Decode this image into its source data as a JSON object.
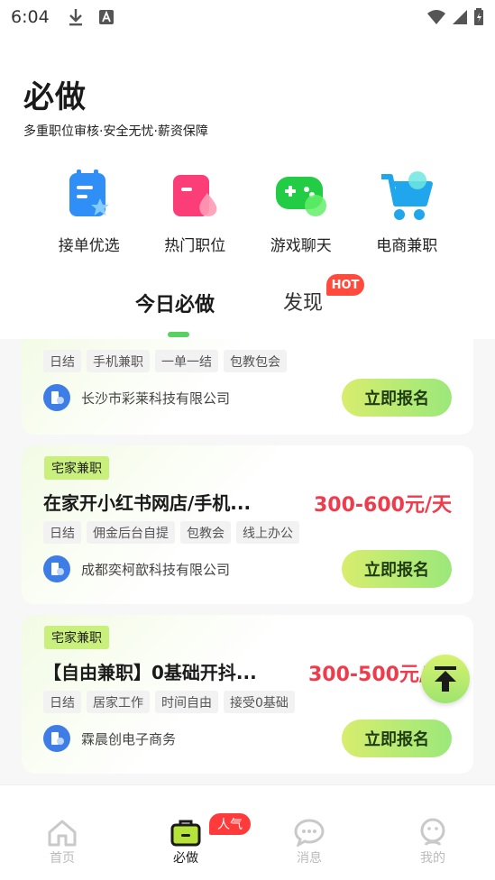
{
  "status_bar": {
    "time": "6:04"
  },
  "header": {
    "title": "必做",
    "subtitle": "多重职位审核·安全无忧·薪资保障"
  },
  "categories": [
    {
      "label": "接单优选",
      "icon": "clipboard-star-icon"
    },
    {
      "label": "热门职位",
      "icon": "hot-folder-icon"
    },
    {
      "label": "游戏聊天",
      "icon": "gamepad-icon"
    },
    {
      "label": "电商兼职",
      "icon": "shopping-cart-icon"
    }
  ],
  "tabs": [
    {
      "label": "今日必做",
      "active": true
    },
    {
      "label": "发现",
      "badge": "HOT"
    }
  ],
  "jobs": [
    {
      "tags": [
        "日结",
        "手机兼职",
        "一单一结",
        "包教包会"
      ],
      "company": "长沙市彩莱科技有限公司",
      "apply_label": "立即报名"
    },
    {
      "category": "宅家兼职",
      "title": "在家开小红书网店/手机...",
      "salary": "300-600元/天",
      "tags": [
        "日结",
        "佣金后台自提",
        "包教会",
        "线上办公"
      ],
      "company": "成都奕柯歆科技有限公司",
      "apply_label": "立即报名"
    },
    {
      "category": "宅家兼职",
      "title": "【自由兼职】0基础开抖...",
      "salary": "300-500元/",
      "tags": [
        "日结",
        "居家工作",
        "时间自由",
        "接受0基础"
      ],
      "company": "霖晨创电子商务",
      "apply_label": "立即报名"
    }
  ],
  "bottom_nav": [
    {
      "label": "首页",
      "icon": "home-icon",
      "active": false
    },
    {
      "label": "必做",
      "icon": "briefcase-icon",
      "active": true,
      "badge": "人气"
    },
    {
      "label": "消息",
      "icon": "chat-bubble-icon",
      "active": false
    },
    {
      "label": "我的",
      "icon": "profile-icon",
      "active": false
    }
  ],
  "colors": {
    "accent_green": "#c9ef7c",
    "salary_red": "#ef3c4c",
    "hot_red": "#ff4b3e"
  }
}
